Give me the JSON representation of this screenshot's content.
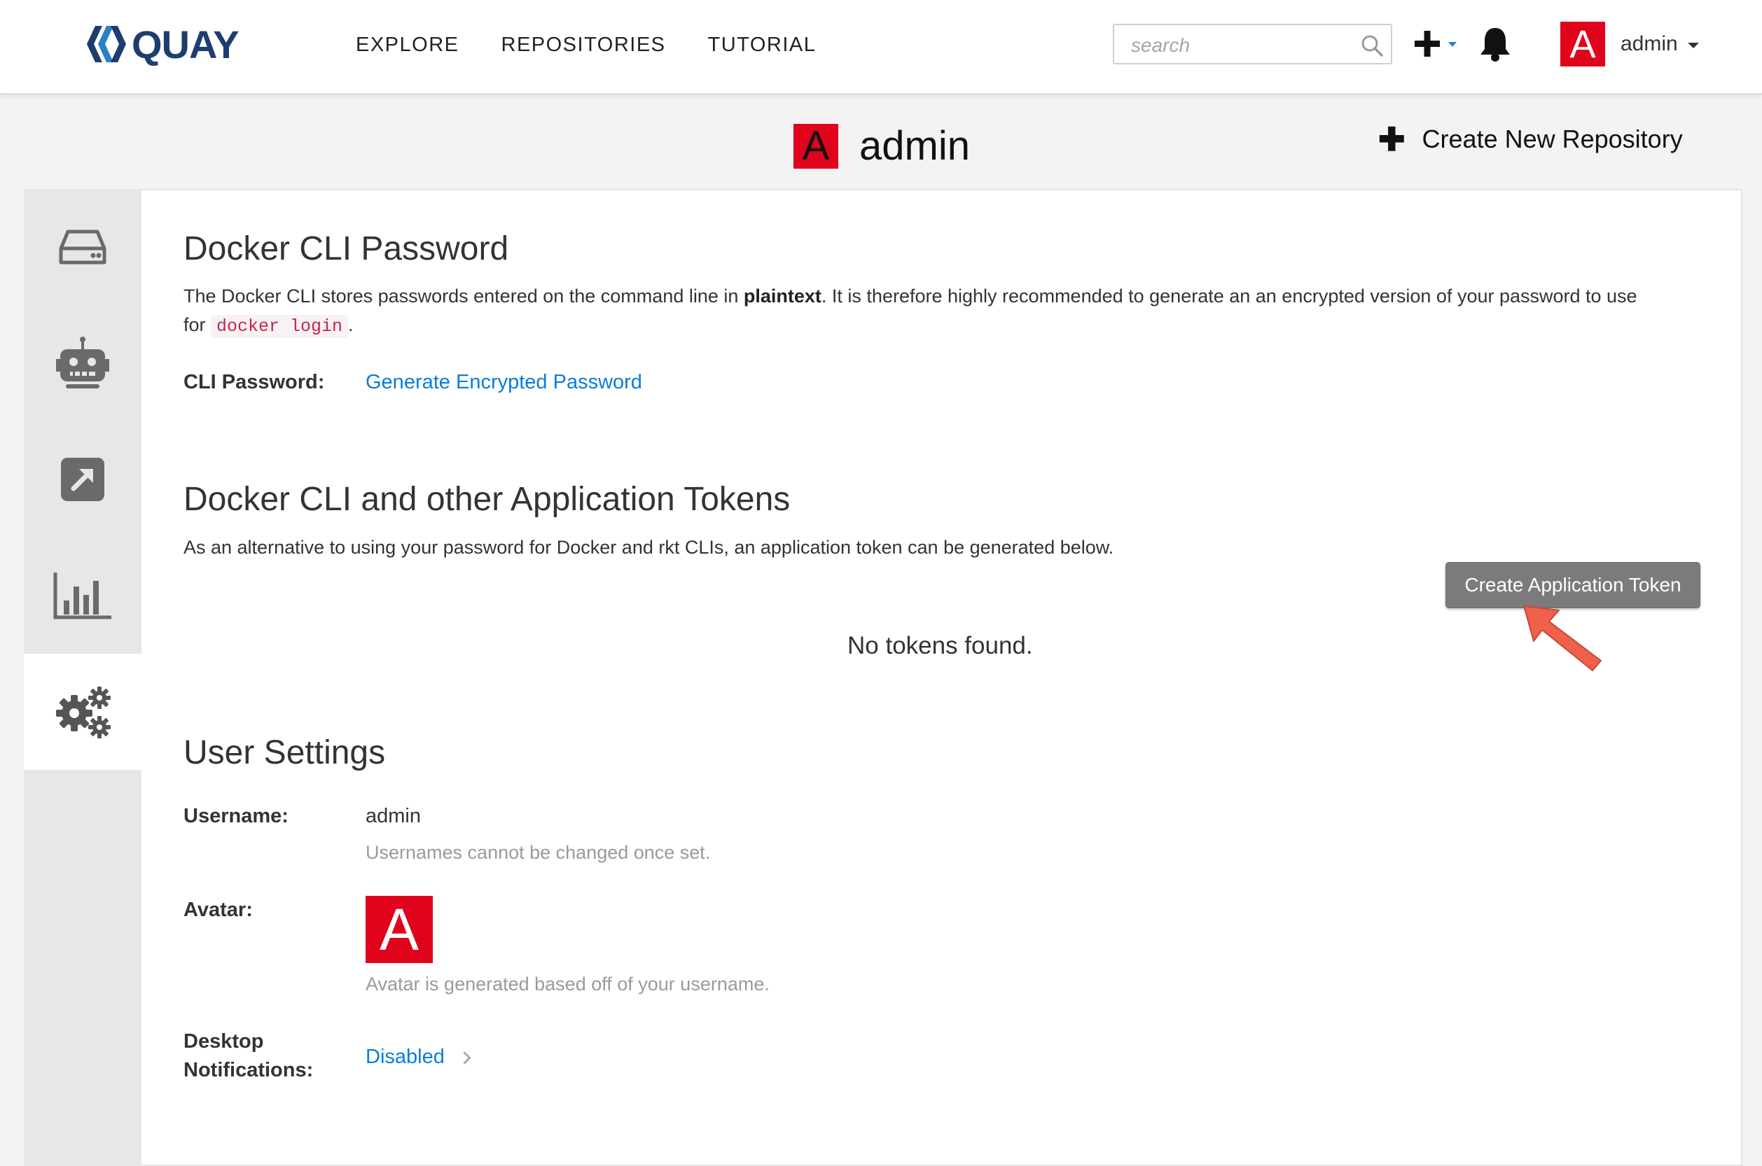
{
  "navbar": {
    "logo_text": "QUAY",
    "links": [
      "EXPLORE",
      "REPOSITORIES",
      "TUTORIAL"
    ],
    "search_placeholder": "search",
    "user_avatar_letter": "A",
    "user_name": "admin"
  },
  "header": {
    "avatar_letter": "A",
    "title": "admin",
    "create_repo_label": "Create New Repository"
  },
  "sidebar": {
    "tabs": [
      {
        "icon": "hard-drive-icon",
        "active": false
      },
      {
        "icon": "robot-icon",
        "active": false
      },
      {
        "icon": "external-link-icon",
        "active": false
      },
      {
        "icon": "bar-chart-icon",
        "active": false
      },
      {
        "icon": "gears-icon",
        "active": true
      }
    ]
  },
  "cli_password": {
    "heading": "Docker CLI Password",
    "desc_part1": "The Docker CLI stores passwords entered on the command line in ",
    "desc_bold": "plaintext",
    "desc_part2": ". It is therefore highly recommended to generate an an encrypted version of your password to use",
    "desc_part3": "for ",
    "desc_code": "docker login",
    "desc_part4": ".",
    "label": "CLI Password:",
    "link": "Generate Encrypted Password"
  },
  "tokens": {
    "heading": "Docker CLI and other Application Tokens",
    "desc": "As an alternative to using your password for Docker and rkt CLIs, an application token can be generated below.",
    "button": "Create Application Token",
    "empty": "No tokens found."
  },
  "user_settings": {
    "heading": "User Settings",
    "username_label": "Username:",
    "username_value": "admin",
    "username_help": "Usernames cannot be changed once set.",
    "avatar_label": "Avatar:",
    "avatar_letter": "A",
    "avatar_help": "Avatar is generated based off of your username.",
    "notif_label_line1": "Desktop",
    "notif_label_line2": "Notifications:",
    "notif_value": "Disabled"
  },
  "colors": {
    "avatar_red": "#e1031b",
    "link_blue": "#0a7cdc",
    "annotation_arrow": "#f0604a"
  }
}
